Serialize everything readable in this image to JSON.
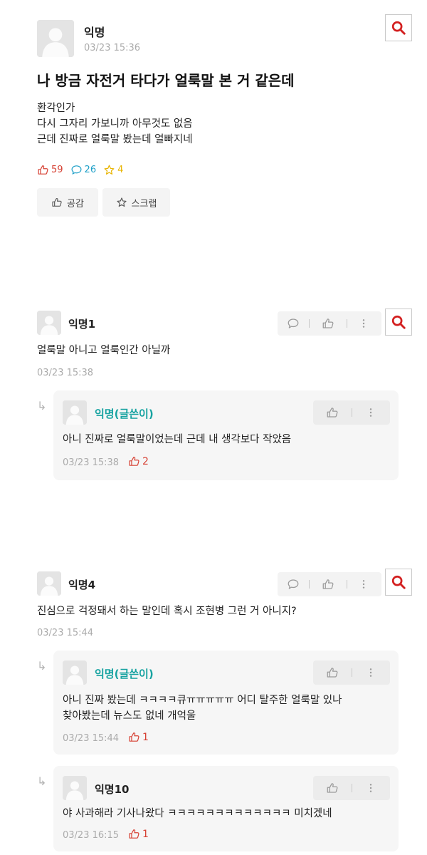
{
  "post": {
    "author": "익명",
    "time": "03/23 15:36",
    "title": "나 방금 자전거 타다가 얼룩말 본 거 같은데",
    "lines": [
      "환각인가",
      "다시 그자리 가보니까 아무것도 없음",
      "근데 진짜로 얼룩말 봤는데 얼빠지네"
    ],
    "likes": "59",
    "comments": "26",
    "scraps": "4",
    "like_button": "공감",
    "scrap_button": "스크랩"
  },
  "comment1": {
    "author": "익명1",
    "text": "얼룩말 아니고 얼룩인간 아닐까",
    "time": "03/23 15:38",
    "reply": {
      "author": "익명(글쓴이)",
      "text": "아니 진짜로 얼룩말이었는데 근데 내 생각보다 작았음",
      "time": "03/23 15:38",
      "likes": "2"
    }
  },
  "comment2": {
    "author": "익명4",
    "text": "진심으로 걱정돼서 하는 말인데 혹시 조현병 그런 거 아니지?",
    "time": "03/23 15:44",
    "reply1": {
      "author": "익명(글쓴이)",
      "line1": "아니 진짜 봤는데 ㅋㅋㅋㅋ큐ㅠㅠㅠㅠㅠ 어디 탈주한 얼룩말 있나",
      "line2": "찾아봤는데 뉴스도 없네 개억울",
      "time": "03/23 15:44",
      "likes": "1"
    },
    "reply2": {
      "author": "익명10",
      "text": "야 사과해라 기사나왔다 ㅋㅋㅋㅋㅋㅋㅋㅋㅋㅋㅋㅋㅋ 미치겠네",
      "time": "03/23 16:15",
      "likes": "1"
    }
  },
  "colors": {
    "like_red": "#d64033",
    "comment_blue": "#1fa0c8",
    "scrap_yellow": "#e8b400",
    "op_teal": "#17a3a1",
    "search_red": "#d32020"
  }
}
